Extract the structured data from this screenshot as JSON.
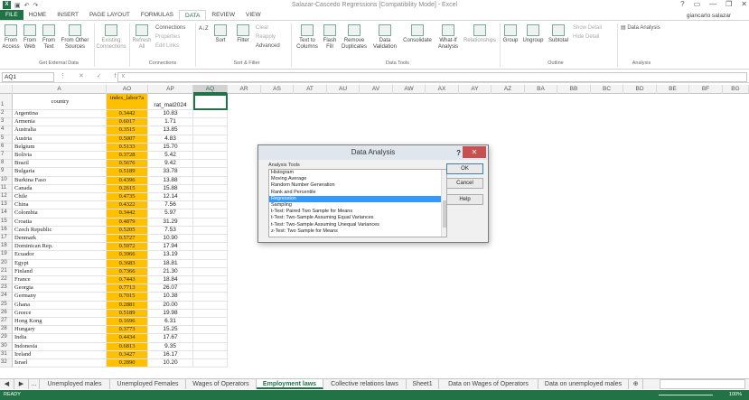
{
  "window": {
    "title": "Salazar-Cascedo Regressions [Compatibility Mode] - Excel",
    "user": "giancarlo salazar",
    "controls": [
      "?",
      "▭",
      "—",
      "❐",
      "✕"
    ]
  },
  "tabs": [
    "FILE",
    "HOME",
    "INSERT",
    "PAGE LAYOUT",
    "FORMULAS",
    "DATA",
    "REVIEW",
    "VIEW"
  ],
  "ribbon": {
    "from_access": "From Access",
    "from_web": "From Web",
    "from_text": "From Text",
    "from_other": "From Other Sources",
    "existing_connections": "Existing Connections",
    "refresh_all": "Refresh All",
    "connections": "Connections",
    "properties": "Properties",
    "edit_links": "Edit Links",
    "sort": "Sort",
    "filter": "Filter",
    "clear": "Clear",
    "reapply": "Reapply",
    "advanced": "Advanced",
    "text_to_columns": "Text to Columns",
    "flash_fill": "Flash Fill",
    "remove_duplicates": "Remove Duplicates",
    "data_validation": "Data Validation",
    "consolidate": "Consolidate",
    "what_if": "What-If Analysis",
    "relationships": "Relationships",
    "group": "Group",
    "ungroup": "Ungroup",
    "subtotal": "Subtotal",
    "show_detail": "Show Detail",
    "hide_detail": "Hide Detail",
    "data_analysis": "Data Analysis",
    "groups": {
      "get_external": "Get External Data",
      "connections": "Connections",
      "sort_filter": "Sort & Filter",
      "data_tools": "Data Tools",
      "outline": "Outline",
      "analysis": "Analysis"
    }
  },
  "formula_bar": {
    "name_box": "AQ1",
    "icons": "⋮ ✕ ✓ fx",
    "value": ""
  },
  "columns": [
    "A",
    "AO",
    "AP",
    "AQ",
    "AR",
    "AS",
    "AT",
    "AU",
    "AV",
    "AW",
    "AX",
    "AY",
    "AZ",
    "BA",
    "BB",
    "BC",
    "BD",
    "BE",
    "BF",
    "BG"
  ],
  "header_row": {
    "country": "country",
    "ao": "index_labor7a",
    "ap": "rat_mal2024"
  },
  "rows": [
    [
      "2",
      "Argentina",
      "0.3442",
      "10.83"
    ],
    [
      "3",
      "Armenia",
      "0.6017",
      "1.71"
    ],
    [
      "4",
      "Australia",
      "0.3515",
      "13.85"
    ],
    [
      "5",
      "Austria",
      "0.5007",
      "4.83"
    ],
    [
      "6",
      "Belgium",
      "0.5133",
      "15.70"
    ],
    [
      "7",
      "Bolivia",
      "0.3728",
      "5.42"
    ],
    [
      "8",
      "Brazil",
      "0.5676",
      "9.42"
    ],
    [
      "9",
      "Bulgaria",
      "0.5189",
      "33.78"
    ],
    [
      "10",
      "Burkina Faso",
      "0.4396",
      "13.88"
    ],
    [
      "11",
      "Canada",
      "0.2615",
      "15.88"
    ],
    [
      "12",
      "Chile",
      "0.4735",
      "12.14"
    ],
    [
      "13",
      "China",
      "0.4322",
      "7.56"
    ],
    [
      "14",
      "Colombia",
      "0.3442",
      "5.97"
    ],
    [
      "15",
      "Croatia",
      "0.4879",
      "31.29"
    ],
    [
      "16",
      "Czech Republic",
      "0.5205",
      "7.53"
    ],
    [
      "17",
      "Denmark",
      "0.5727",
      "10.90"
    ],
    [
      "18",
      "Dominican Rep.",
      "0.5972",
      "17.94"
    ],
    [
      "19",
      "Ecuador",
      "0.3966",
      "13.19"
    ],
    [
      "20",
      "Egypt",
      "0.3683",
      "18.81"
    ],
    [
      "21",
      "Finland",
      "0.7366",
      "21.30"
    ],
    [
      "22",
      "France",
      "0.7443",
      "18.84"
    ],
    [
      "23",
      "Georgia",
      "0.7713",
      "26.07"
    ],
    [
      "24",
      "Germany",
      "0.7015",
      "10.38"
    ],
    [
      "25",
      "Ghana",
      "0.2881",
      "20.00"
    ],
    [
      "26",
      "Greece",
      "0.5189",
      "19.98"
    ],
    [
      "27",
      "Hong Kong",
      "0.1696",
      "6.31"
    ],
    [
      "28",
      "Hungary",
      "0.3773",
      "15.25"
    ],
    [
      "29",
      "India",
      "0.4434",
      "17.67"
    ],
    [
      "30",
      "Indonesia",
      "0.6813",
      "9.35"
    ],
    [
      "31",
      "Ireland",
      "0.3427",
      "16.17"
    ],
    [
      "32",
      "Israel",
      "0.2890",
      "10.20"
    ]
  ],
  "dialog": {
    "title": "Data Analysis",
    "help": "?",
    "close": "✕",
    "label": "Analysis Tools",
    "items": [
      "Histogram",
      "Moving Average",
      "Random Number Generation",
      "Rank and Percentile",
      "Regression",
      "Sampling",
      "t-Test: Paired Two Sample for Means",
      "t-Test: Two-Sample Assuming Equal Variances",
      "t-Test: Two-Sample Assuming Unequal Variances",
      "z-Test: Two Sample for Means"
    ],
    "selected": "Regression",
    "ok": "OK",
    "cancel": "Cancel",
    "help_btn": "Help"
  },
  "sheets": [
    "...",
    "Unemployed males",
    "Unemployed Females",
    "Wages of Operators",
    "Employment laws",
    "Collective relations laws",
    "Sheet1",
    "Data on Wages of Operators",
    "Data on unemployed males"
  ],
  "active_sheet": "Employment laws",
  "status": {
    "ready": "READY",
    "zoom": "100%"
  }
}
